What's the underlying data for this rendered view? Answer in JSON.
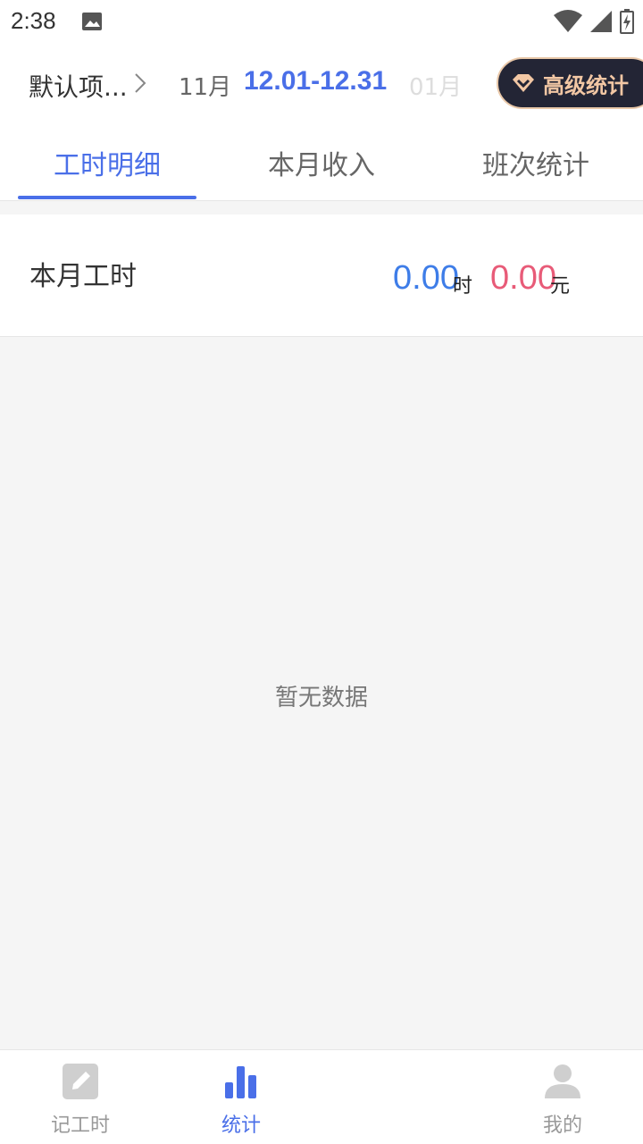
{
  "status_bar": {
    "time": "2:38"
  },
  "header": {
    "project_name": "默认项...",
    "prev_month": "11月",
    "date_range": "12.01-12.31",
    "next_month": "01月",
    "pro_label": "高级统计"
  },
  "tabs": [
    {
      "label": "工时明细",
      "active": true
    },
    {
      "label": "本月收入",
      "active": false
    },
    {
      "label": "班次统计",
      "active": false
    }
  ],
  "summary": {
    "label": "本月工时",
    "hours": "0.00",
    "hours_unit": "时",
    "income": "0.00",
    "income_unit": "元"
  },
  "empty_message": "暂无数据",
  "bottom_nav": [
    {
      "label": "记工时",
      "icon": "edit-icon",
      "active": false
    },
    {
      "label": "统计",
      "icon": "bar-chart-icon",
      "active": true
    },
    {
      "label": "我的",
      "icon": "person-icon",
      "active": false
    }
  ],
  "colors": {
    "accent": "#4a6fe8",
    "hours": "#3e7de8",
    "income": "#e85b78",
    "badge_bg": "#232535",
    "badge_text": "#f2c7a4"
  }
}
